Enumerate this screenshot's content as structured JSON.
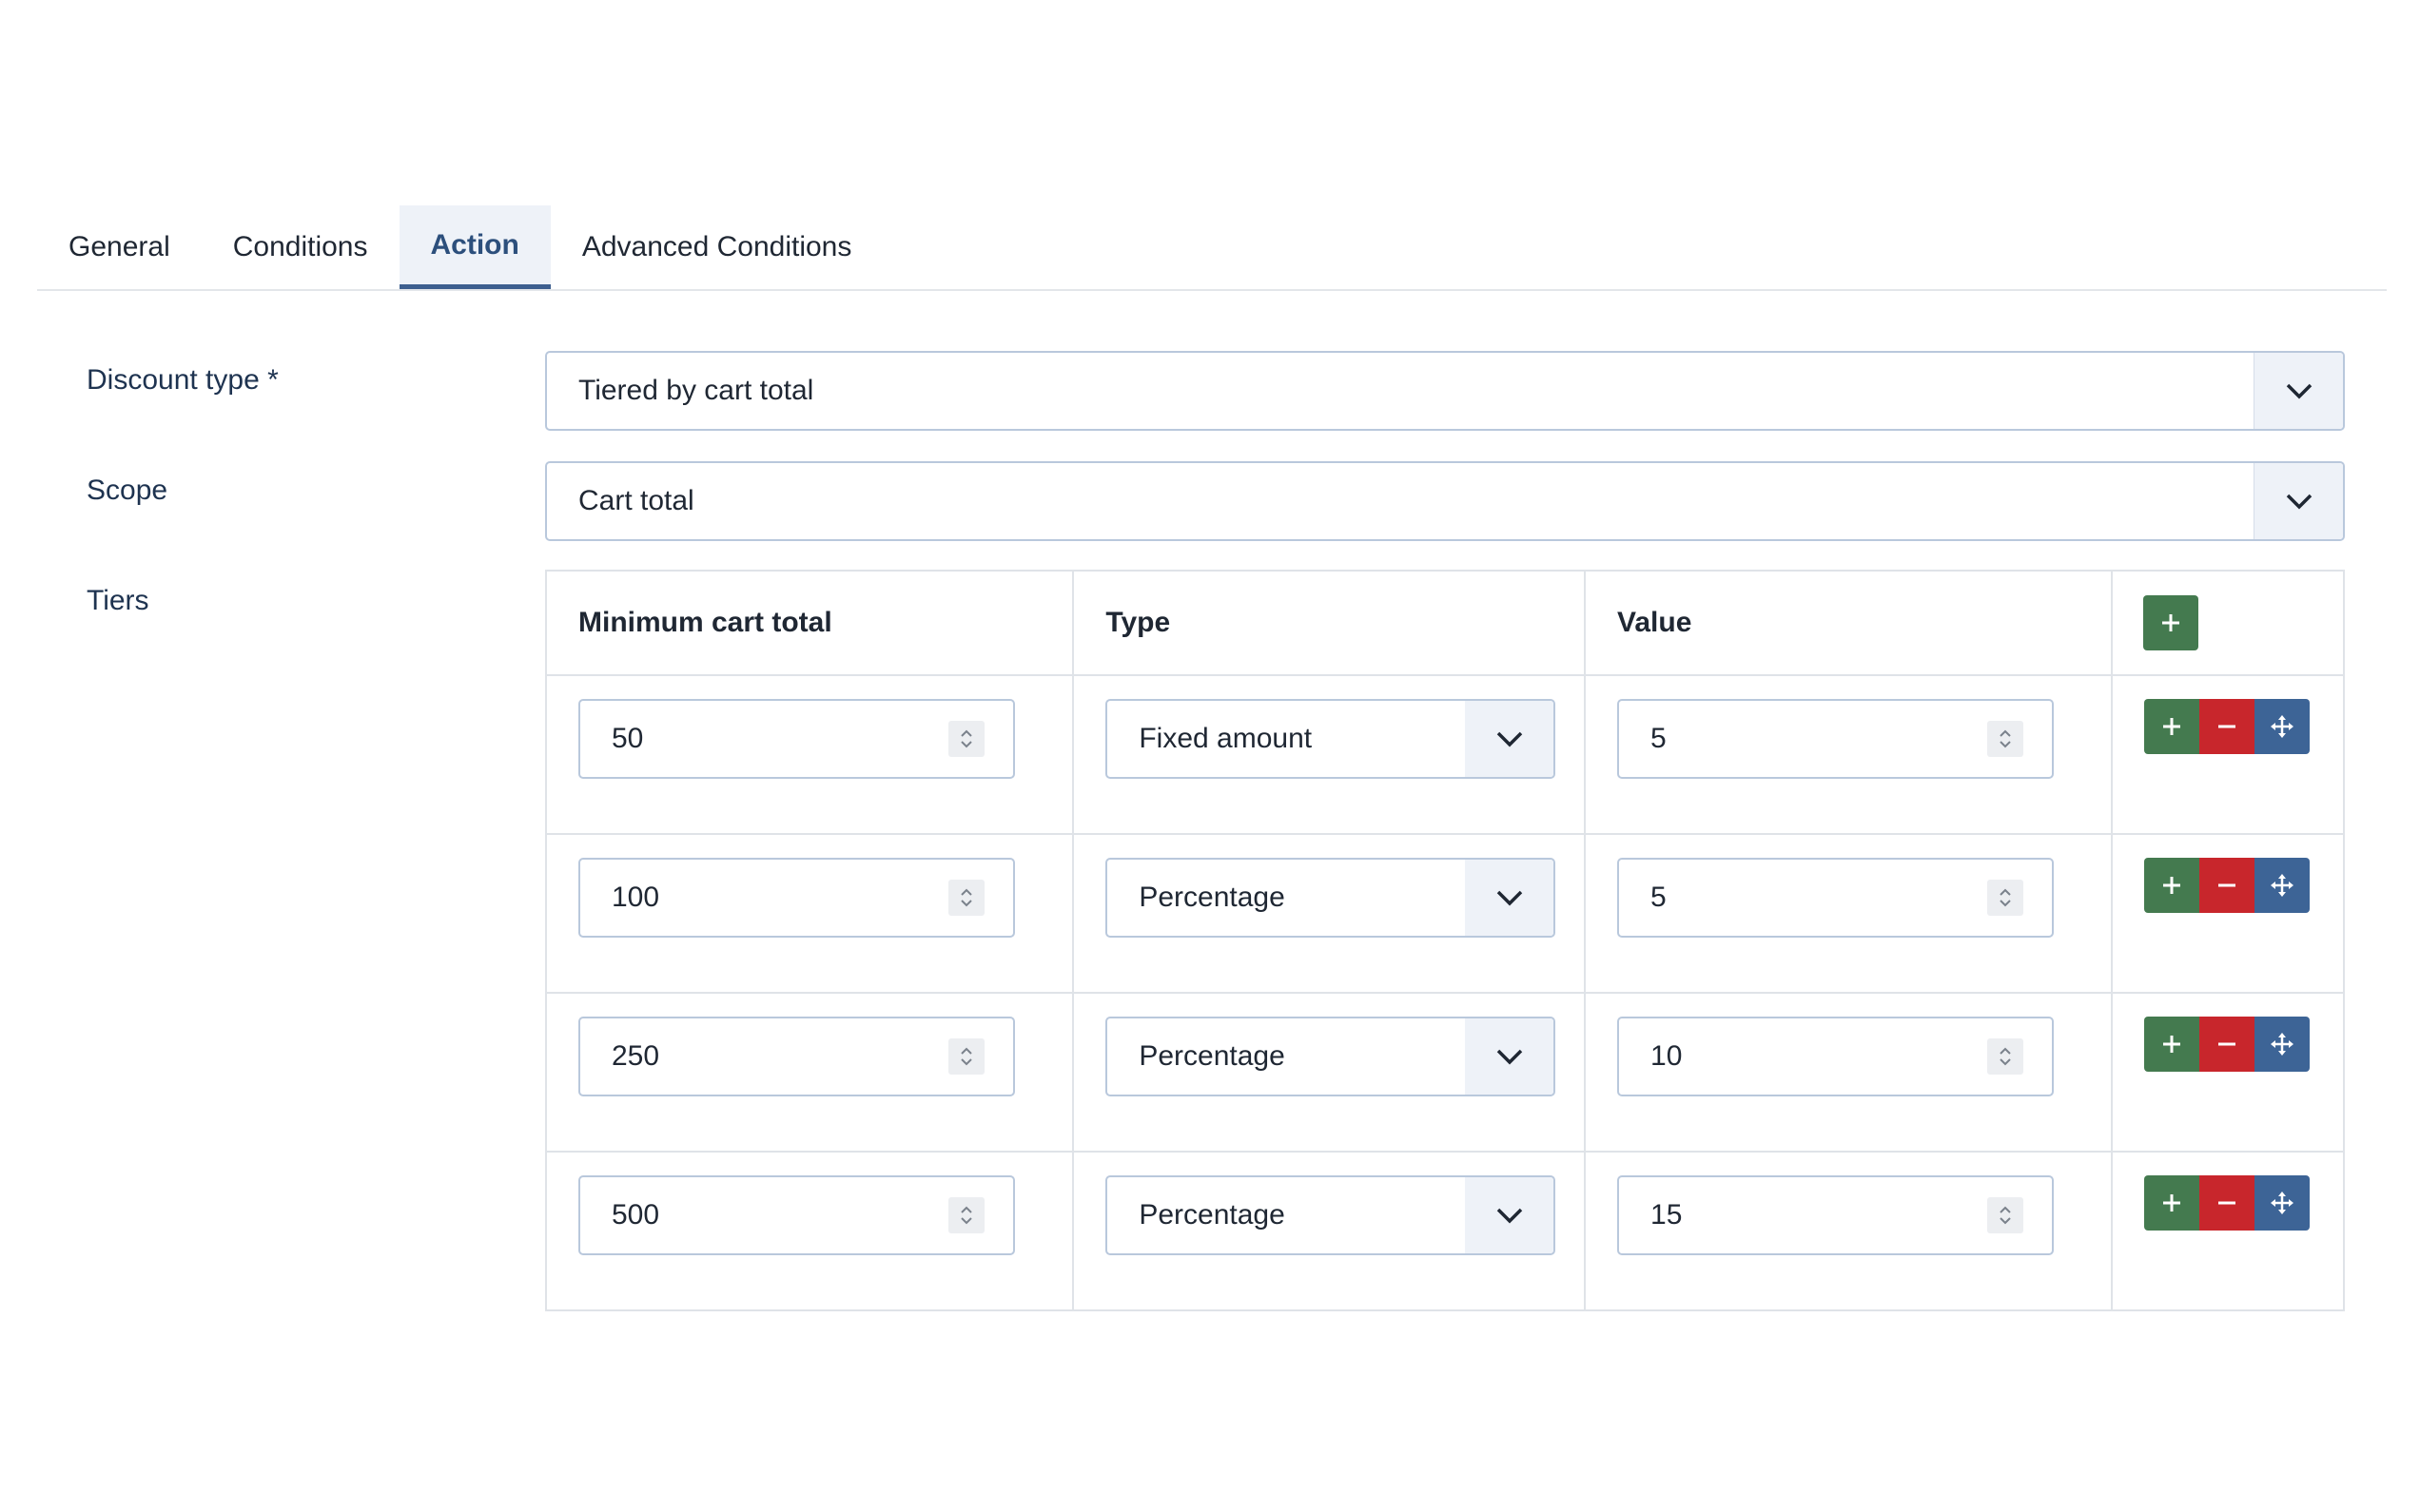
{
  "tabs": [
    {
      "label": "General",
      "active": false
    },
    {
      "label": "Conditions",
      "active": false
    },
    {
      "label": "Action",
      "active": true
    },
    {
      "label": "Advanced Conditions",
      "active": false
    }
  ],
  "form": {
    "discount_type": {
      "label": "Discount type *",
      "value": "Tiered by cart total"
    },
    "scope": {
      "label": "Scope",
      "value": "Cart total"
    },
    "tiers": {
      "label": "Tiers"
    }
  },
  "tiers_table": {
    "headers": {
      "min": "Minimum cart total",
      "type": "Type",
      "value": "Value"
    },
    "rows": [
      {
        "min": "50",
        "type": "Fixed amount",
        "value": "5"
      },
      {
        "min": "100",
        "type": "Percentage",
        "value": "5"
      },
      {
        "min": "250",
        "type": "Percentage",
        "value": "10"
      },
      {
        "min": "500",
        "type": "Percentage",
        "value": "15"
      }
    ]
  },
  "icons": {
    "dropdown": "chevron-down-icon",
    "spinner": "spinner-updown-icon",
    "add": "plus-icon",
    "remove": "minus-icon",
    "move": "move-arrows-icon"
  },
  "colors": {
    "accent_tab": "#3d5f8f",
    "add_button": "#447a4f",
    "remove_button": "#c8262c",
    "move_button": "#3d6496"
  }
}
